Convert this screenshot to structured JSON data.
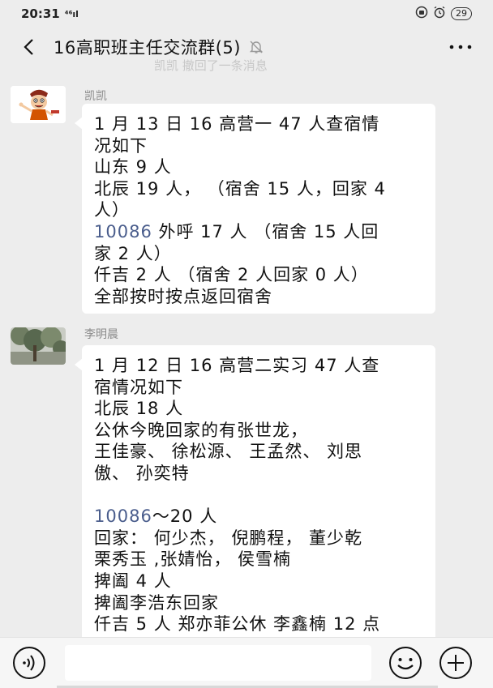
{
  "status_bar": {
    "time": "20:31",
    "signal_text": "⁴⁶ıl",
    "battery": "29"
  },
  "title_bar": {
    "title": "16高职班主任交流群(5)",
    "faded_text": "凯凯 撤回了一条消息"
  },
  "messages": [
    {
      "sender": "凯凯",
      "avatar": "cartoon-avatar",
      "lines": [
        {
          "text": "1 月 13 日 16 高营一 47 人查宿情"
        },
        {
          "text": "况如下"
        },
        {
          "text": "山东 9 人"
        },
        {
          "text": "北辰 19 人， （宿舍 15 人，回家 4"
        },
        {
          "text": "人）"
        },
        {
          "text": " 外呼 17 人 （宿舍 15 人回",
          "link": "10086"
        },
        {
          "text": "家 2 人）"
        },
        {
          "text": "仟吉 2 人 （宿舍 2 人回家 0 人）"
        },
        {
          "text": "全部按时按点返回宿舍"
        }
      ]
    },
    {
      "sender": "李明晨",
      "avatar": "tree-avatar",
      "lines": [
        {
          "text": "1 月 12 日 16 高营二实习 47 人查"
        },
        {
          "text": "宿情况如下"
        },
        {
          "text": "北辰 18 人"
        },
        {
          "text": "公休今晚回家的有张世龙，"
        },
        {
          "text": "王佳豪、 徐松源、 王孟然、 刘思"
        },
        {
          "text": "傲、 孙奕特"
        },
        {
          "text": ""
        },
        {
          "text": "～20 人",
          "link": "10086"
        },
        {
          "text": "回家： 何少杰， 倪鹏程， 董少乾"
        },
        {
          "text": "栗秀玉 ,张婧怡， 侯雪楠"
        },
        {
          "text": "捭阖 4 人"
        },
        {
          "text": "捭阖李浩东回家"
        },
        {
          "text": "仟吉 5 人 郑亦菲公休 李鑫楠 12 点"
        }
      ]
    }
  ],
  "input_bar": {
    "placeholder": ""
  },
  "colors": {
    "background": "#ededed",
    "bubble": "#ffffff",
    "link": "#4a5d8c"
  }
}
